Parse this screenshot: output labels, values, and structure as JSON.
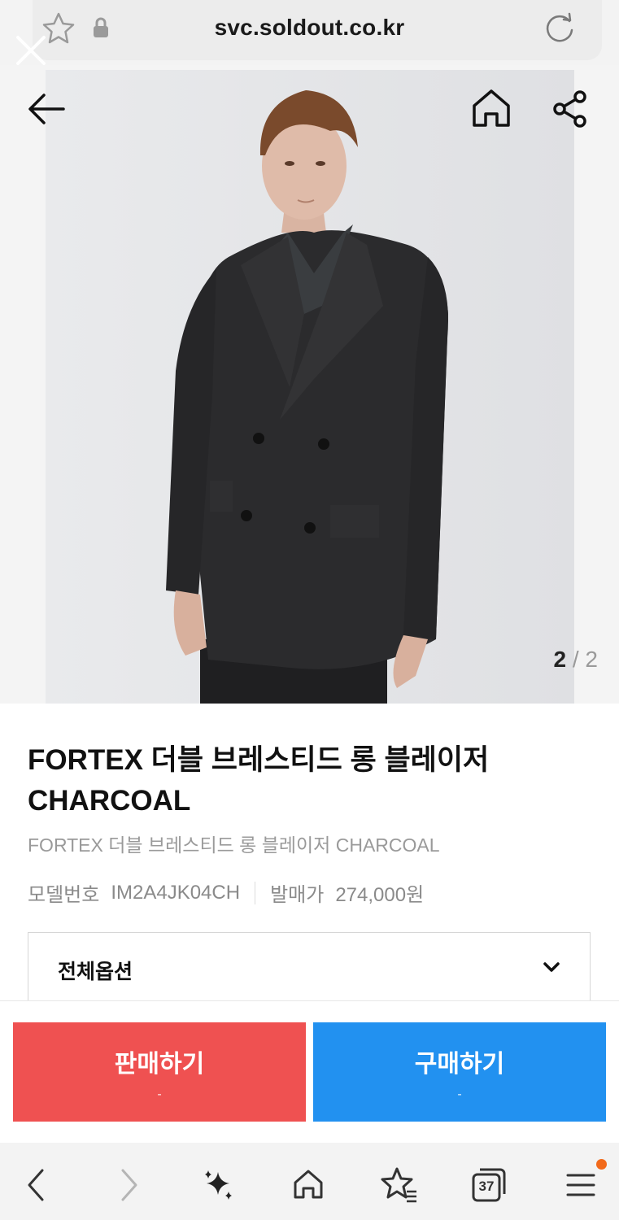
{
  "browser": {
    "url": "svc.soldout.co.kr",
    "tab_count": "37"
  },
  "product": {
    "image_counter": {
      "current": "2",
      "separator": "/",
      "total": "2"
    },
    "title_line1": "FORTEX 더블 브레스티드 롱 블레이저",
    "title_line2": "CHARCOAL",
    "subtitle": "FORTEX 더블 브레스티드 롱 블레이저 CHARCOAL",
    "model_label": "모델번호",
    "model_value": "IM2A4JK04CH",
    "release_label": "발매가",
    "release_value": "274,000원",
    "options_label": "전체옵션"
  },
  "actions": {
    "sell_label": "판매하기",
    "sell_price": "-",
    "buy_label": "구매하기",
    "buy_price": "-"
  },
  "colors": {
    "sell": "#ef5151",
    "buy": "#2291f0",
    "notification_dot": "#f26a1b"
  },
  "icons": [
    "close-icon",
    "star-icon",
    "lock-icon",
    "reload-icon",
    "back-arrow-icon",
    "home-icon",
    "share-icon",
    "chevron-down-icon",
    "nav-back-icon",
    "nav-forward-icon",
    "sparkle-icon",
    "nav-home-icon",
    "bookmark-star-icon",
    "tabs-icon",
    "menu-icon"
  ]
}
